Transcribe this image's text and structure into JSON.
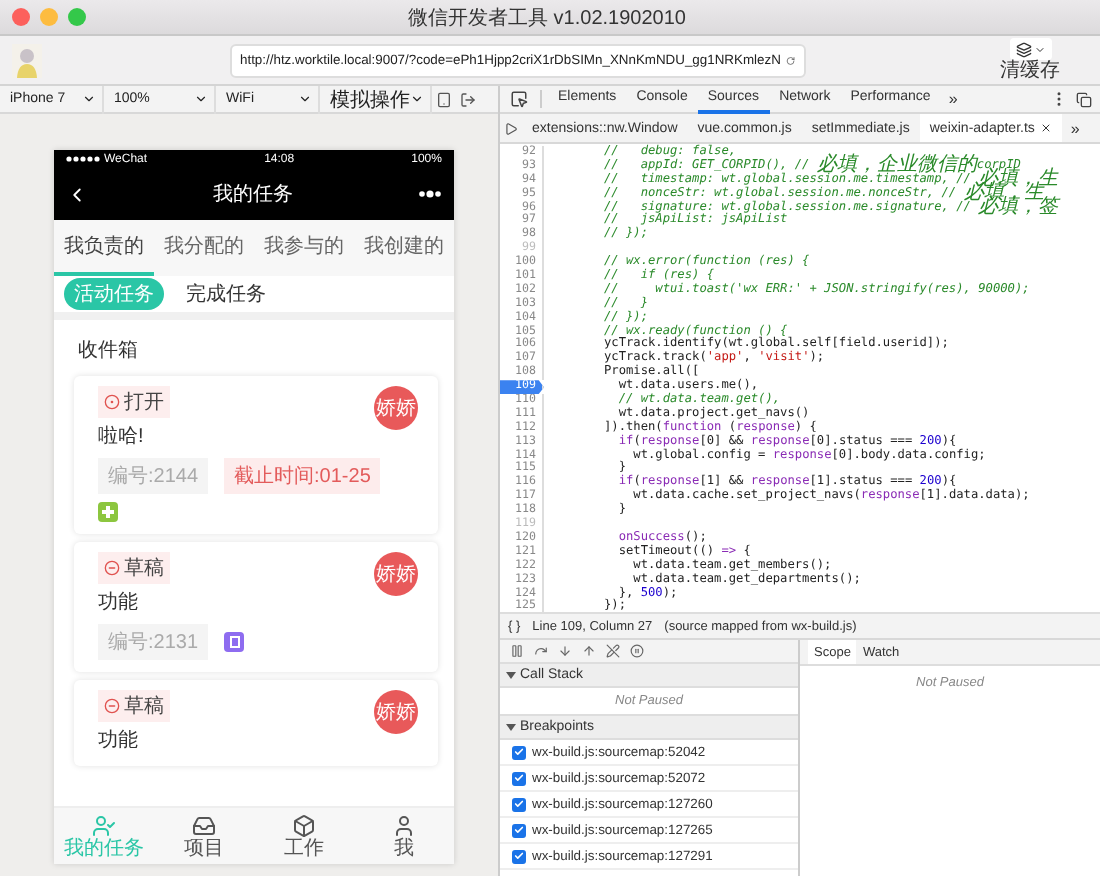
{
  "window": {
    "title": "微信开发者工具 v1.02.1902010"
  },
  "toolbar": {
    "url": "http://htz.worktile.local:9007/?code=ePh1Hjpp2criX1rDbSIMn_XNnKmNDU_gg1NRKmlezN",
    "cache_button": "清缓存"
  },
  "simulator_controls": [
    {
      "label": "iPhone 7"
    },
    {
      "label": "100%"
    },
    {
      "label": "WiFi"
    },
    {
      "label": "模拟操作"
    }
  ],
  "phone": {
    "status_bar": {
      "carrier": "WeChat",
      "time": "14:08",
      "battery": "100%"
    },
    "nav_title": "我的任务",
    "tabs": [
      {
        "label": "我负责的",
        "selected": true
      },
      {
        "label": "我分配的",
        "selected": false
      },
      {
        "label": "我参与的",
        "selected": false
      },
      {
        "label": "我创建的",
        "selected": false
      }
    ],
    "filters": [
      {
        "label": "活动任务",
        "selected": true
      },
      {
        "label": "完成任务",
        "selected": false
      }
    ],
    "section_title": "收件箱",
    "tasks": [
      {
        "kind": "open",
        "status": "打开",
        "assignee": "娇娇",
        "title": "啦哈!",
        "number": "编号:2144",
        "due": "截止时间:01-25",
        "color": "#8cc63f"
      },
      {
        "kind": "draft",
        "status": "草稿",
        "assignee": "娇娇",
        "title": "功能",
        "number": "编号:2131",
        "color": "#8e6cf0"
      },
      {
        "kind": "draft",
        "status": "草稿",
        "assignee": "娇娇",
        "title": "功能"
      }
    ],
    "bottom_tabs": [
      {
        "label": "我的任务",
        "kind": "tasks",
        "selected": true
      },
      {
        "label": "项目",
        "kind": "projects",
        "selected": false
      },
      {
        "label": "工作",
        "kind": "work",
        "selected": false
      },
      {
        "label": "我",
        "kind": "me",
        "selected": false
      }
    ]
  },
  "devtools": {
    "tabs": [
      {
        "label": "Elements",
        "selected": false
      },
      {
        "label": "Console",
        "selected": false
      },
      {
        "label": "Sources",
        "selected": true
      },
      {
        "label": "Network",
        "selected": false
      },
      {
        "label": "Performance",
        "selected": false
      }
    ],
    "more": "»",
    "files": [
      {
        "label": "extensions::nw.Window",
        "selected": false
      },
      {
        "label": "vue.common.js",
        "selected": false
      },
      {
        "label": "setImmediate.js",
        "selected": false
      },
      {
        "label": "weixin-adapter.ts",
        "selected": true
      }
    ],
    "files_more": "»",
    "code": [
      {
        "number": "92",
        "breakpoint": false,
        "tokens": [
          {
            "text": "//   debug: false,",
            "kind": "comment"
          }
        ]
      },
      {
        "number": "93",
        "breakpoint": false,
        "tokens": [
          {
            "text": "//   appId: GET_CORPID(), // 必填，企业微信的corpID",
            "kind": "comment"
          }
        ]
      },
      {
        "number": "94",
        "breakpoint": false,
        "tokens": [
          {
            "text": "//   timestamp: wt.global.session.me.timestamp, // 必填，生",
            "kind": "comment"
          }
        ]
      },
      {
        "number": "95",
        "breakpoint": false,
        "tokens": [
          {
            "text": "//   nonceStr: wt.global.session.me.nonceStr, // 必填，生",
            "kind": "comment"
          }
        ]
      },
      {
        "number": "96",
        "breakpoint": false,
        "tokens": [
          {
            "text": "//   signature: wt.global.session.me.signature, // 必填，签",
            "kind": "comment"
          }
        ]
      },
      {
        "number": "97",
        "breakpoint": false,
        "tokens": [
          {
            "text": "//   jsApiList: jsApiList",
            "kind": "comment"
          }
        ]
      },
      {
        "number": "98",
        "breakpoint": false,
        "tokens": [
          {
            "text": "// });",
            "kind": "comment"
          }
        ]
      },
      {
        "number": "99",
        "breakpoint": false
      },
      {
        "number": "100",
        "breakpoint": false,
        "tokens": [
          {
            "text": "// wx.error(function (res) {",
            "kind": "comment"
          }
        ]
      },
      {
        "number": "101",
        "breakpoint": false,
        "tokens": [
          {
            "text": "//   if (res) {",
            "kind": "comment"
          }
        ]
      },
      {
        "number": "102",
        "breakpoint": false,
        "tokens": [
          {
            "text": "//     wtui.toast('wx ERR:' + JSON.stringify(res), 90000);",
            "kind": "comment"
          }
        ]
      },
      {
        "number": "103",
        "breakpoint": false,
        "tokens": [
          {
            "text": "//   }",
            "kind": "comment"
          }
        ]
      },
      {
        "number": "104",
        "breakpoint": false,
        "tokens": [
          {
            "text": "// });",
            "kind": "comment"
          }
        ]
      },
      {
        "number": "105",
        "breakpoint": false,
        "tokens": [
          {
            "text": "// wx.ready(function () {",
            "kind": "comment"
          }
        ]
      },
      {
        "number": "106",
        "breakpoint": false,
        "tokens": [
          {
            "text": "ycTrack.identify(wt.global.self[field.userid]);",
            "kind": "plain"
          }
        ]
      },
      {
        "number": "107",
        "breakpoint": false,
        "tokens": [
          {
            "text": "ycTrack.track(",
            "kind": "plain"
          },
          {
            "text": "'app'",
            "kind": "string"
          },
          {
            "text": ", ",
            "kind": "plain"
          },
          {
            "text": "'visit'",
            "kind": "string"
          },
          {
            "text": ");",
            "kind": "plain"
          }
        ]
      },
      {
        "number": "108",
        "breakpoint": false,
        "tokens": [
          {
            "text": "Promise.all([",
            "kind": "plain"
          }
        ]
      },
      {
        "number": "109",
        "breakpoint": true,
        "tokens": [
          {
            "text": "  wt.data.users.me(),",
            "kind": "plain"
          }
        ]
      },
      {
        "number": "110",
        "breakpoint": false,
        "tokens": [
          {
            "text": "  // wt.data.team.get(),",
            "kind": "comment"
          }
        ]
      },
      {
        "number": "111",
        "breakpoint": false,
        "tokens": [
          {
            "text": "  wt.data.project.get_navs()",
            "kind": "plain"
          }
        ]
      },
      {
        "number": "112",
        "breakpoint": false,
        "tokens": [
          {
            "text": "]).then(",
            "kind": "plain"
          },
          {
            "text": "function",
            "kind": "keyword"
          },
          {
            "text": " (",
            "kind": "plain"
          },
          {
            "text": "response",
            "kind": "keyword"
          },
          {
            "text": ") {",
            "kind": "plain"
          }
        ]
      },
      {
        "number": "113",
        "breakpoint": false,
        "tokens": [
          {
            "text": "  if",
            "kind": "keyword"
          },
          {
            "text": "(",
            "kind": "plain"
          },
          {
            "text": "response",
            "kind": "keyword"
          },
          {
            "text": "[0] && ",
            "kind": "plain"
          },
          {
            "text": "response",
            "kind": "keyword"
          },
          {
            "text": "[0].status === ",
            "kind": "plain"
          },
          {
            "text": "200",
            "kind": "number"
          },
          {
            "text": "){",
            "kind": "plain"
          }
        ]
      },
      {
        "number": "114",
        "breakpoint": false,
        "tokens": [
          {
            "text": "    wt.global.config = ",
            "kind": "plain"
          },
          {
            "text": "response",
            "kind": "keyword"
          },
          {
            "text": "[0].body.data.config;",
            "kind": "plain"
          }
        ]
      },
      {
        "number": "115",
        "breakpoint": false,
        "tokens": [
          {
            "text": "  }",
            "kind": "plain"
          }
        ]
      },
      {
        "number": "116",
        "breakpoint": false,
        "tokens": [
          {
            "text": "  if",
            "kind": "keyword"
          },
          {
            "text": "(",
            "kind": "plain"
          },
          {
            "text": "response",
            "kind": "keyword"
          },
          {
            "text": "[1] && ",
            "kind": "plain"
          },
          {
            "text": "response",
            "kind": "keyword"
          },
          {
            "text": "[1].status === ",
            "kind": "plain"
          },
          {
            "text": "200",
            "kind": "number"
          },
          {
            "text": "){",
            "kind": "plain"
          }
        ]
      },
      {
        "number": "117",
        "breakpoint": false,
        "tokens": [
          {
            "text": "    wt.data.cache.set_project_navs(",
            "kind": "plain"
          },
          {
            "text": "response",
            "kind": "keyword"
          },
          {
            "text": "[1].data.data);",
            "kind": "plain"
          }
        ]
      },
      {
        "number": "118",
        "breakpoint": false,
        "tokens": [
          {
            "text": "  }",
            "kind": "plain"
          }
        ]
      },
      {
        "number": "119",
        "breakpoint": false
      },
      {
        "number": "120",
        "breakpoint": false,
        "tokens": [
          {
            "text": "  onSuccess",
            "kind": "keyword"
          },
          {
            "text": "();",
            "kind": "plain"
          }
        ]
      },
      {
        "number": "121",
        "breakpoint": false,
        "tokens": [
          {
            "text": "  setTimeout(() ",
            "kind": "plain"
          },
          {
            "text": "=>",
            "kind": "keyword"
          },
          {
            "text": " {",
            "kind": "plain"
          }
        ]
      },
      {
        "number": "122",
        "breakpoint": false,
        "tokens": [
          {
            "text": "    wt.data.team.get_members();",
            "kind": "plain"
          }
        ]
      },
      {
        "number": "123",
        "breakpoint": false,
        "tokens": [
          {
            "text": "    wt.data.team.get_departments();",
            "kind": "plain"
          }
        ]
      },
      {
        "number": "124",
        "breakpoint": false,
        "tokens": [
          {
            "text": "  }, ",
            "kind": "plain"
          },
          {
            "text": "500",
            "kind": "number"
          },
          {
            "text": ");",
            "kind": "plain"
          }
        ]
      },
      {
        "number": "125",
        "breakpoint": false,
        "tokens": [
          {
            "text": "});",
            "kind": "plain"
          }
        ]
      }
    ],
    "status_line": {
      "braces": "{ }",
      "position": "Line 109, Column 27",
      "source": "(source mapped from wx-build.js)"
    },
    "call_stack": {
      "title": "Call Stack",
      "expanded": true,
      "message": "Not Paused"
    },
    "breakpoints": {
      "title": "Breakpoints",
      "expanded": true,
      "items": [
        {
          "label": "wx-build.js:sourcemap:52042",
          "checked": true
        },
        {
          "label": "wx-build.js:sourcemap:52072",
          "checked": true
        },
        {
          "label": "wx-build.js:sourcemap:127260",
          "checked": true
        },
        {
          "label": "wx-build.js:sourcemap:127265",
          "checked": true
        },
        {
          "label": "wx-build.js:sourcemap:127291",
          "checked": true
        }
      ]
    },
    "side_tabs": [
      {
        "label": "Scope",
        "selected": true
      },
      {
        "label": "Watch",
        "selected": false
      }
    ],
    "side_message": "Not Paused"
  }
}
